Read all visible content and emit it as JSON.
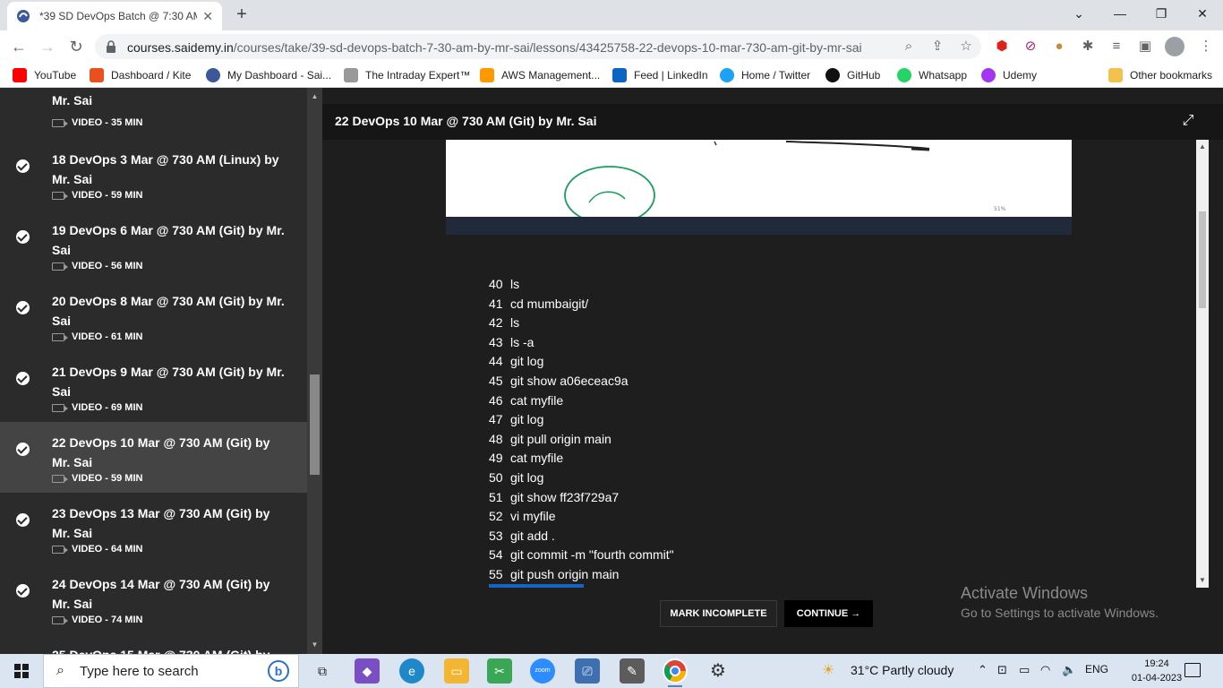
{
  "browser": {
    "tab_title": "*39 SD DevOps Batch @ 7:30 AM",
    "url_host": "courses.saidemy.in",
    "url_path": "/courses/take/39-sd-devops-batch-7-30-am-by-mr-sai/lessons/43425758-22-devops-10-mar-730-am-git-by-mr-sai"
  },
  "bookmarks": [
    {
      "label": "YouTube",
      "color": "#ff0000"
    },
    {
      "label": "Dashboard / Kite",
      "color": "#e8501e"
    },
    {
      "label": "My Dashboard - Sai...",
      "color": "#3b5998"
    },
    {
      "label": "The Intraday Expert™",
      "color": "#888888"
    },
    {
      "label": "AWS Management...",
      "color": "#ff9900"
    },
    {
      "label": "Feed | LinkedIn",
      "color": "#0a66c2"
    },
    {
      "label": "Home / Twitter",
      "color": "#1da1f2"
    },
    {
      "label": "GitHub",
      "color": "#111111"
    },
    {
      "label": "Whatsapp",
      "color": "#25d366"
    },
    {
      "label": "Udemy",
      "color": "#a435f0"
    },
    {
      "label": "Other bookmarks",
      "color": "#f2c14e"
    }
  ],
  "sidebar": {
    "top_partial": {
      "title": "Mr. Sai",
      "meta": "VIDEO - 35 MIN"
    },
    "lessons": [
      {
        "title": "18 DevOps 3 Mar @ 730 AM (Linux) by Mr. Sai",
        "meta": "VIDEO - 59 MIN",
        "completed": true
      },
      {
        "title": "19 DevOps 6 Mar @ 730 AM (Git) by Mr. Sai",
        "meta": "VIDEO - 56 MIN",
        "completed": true
      },
      {
        "title": "20 DevOps 8 Mar @ 730 AM (Git) by Mr. Sai",
        "meta": "VIDEO - 61 MIN",
        "completed": true
      },
      {
        "title": "21 DevOps 9 Mar @ 730 AM (Git) by Mr. Sai",
        "meta": "VIDEO - 69 MIN",
        "completed": true
      },
      {
        "title": "22 DevOps 10 Mar @ 730 AM (Git) by Mr. Sai",
        "meta": "VIDEO - 59 MIN",
        "completed": true,
        "active": true
      },
      {
        "title": "23 DevOps 13 Mar @ 730 AM (Git) by Mr. Sai",
        "meta": "VIDEO - 64 MIN",
        "completed": true
      },
      {
        "title": "24 DevOps 14 Mar @ 730 AM (Git) by Mr. Sai",
        "meta": "VIDEO - 74 MIN",
        "completed": true
      },
      {
        "title": "25 DevOps 15 Mar @ 730 AM (Git) by",
        "meta": "",
        "completed": true
      }
    ]
  },
  "main": {
    "lesson_title": "22 DevOps 10 Mar @ 730 AM (Git) by Mr. Sai",
    "commands": [
      {
        "n": "40",
        "cmd": "ls"
      },
      {
        "n": "41",
        "cmd": "cd mumbaigit/"
      },
      {
        "n": "42",
        "cmd": "ls"
      },
      {
        "n": "43",
        "cmd": "ls -a"
      },
      {
        "n": "44",
        "cmd": "git log"
      },
      {
        "n": "45",
        "cmd": "git show a06eceac9a"
      },
      {
        "n": "46",
        "cmd": "cat myfile"
      },
      {
        "n": "47",
        "cmd": "git log"
      },
      {
        "n": "48",
        "cmd": "git pull origin main"
      },
      {
        "n": "49",
        "cmd": "cat myfile"
      },
      {
        "n": "50",
        "cmd": "git log"
      },
      {
        "n": "51",
        "cmd": "git show ff23f729a7"
      },
      {
        "n": "52",
        "cmd": "vi myfile"
      },
      {
        "n": "53",
        "cmd": "git add ."
      },
      {
        "n": "54",
        "cmd": "git commit -m \"fourth commit\""
      },
      {
        "n": "55",
        "cmd": "git push origin main"
      }
    ],
    "mark_incomplete": "MARK INCOMPLETE",
    "continue": "CONTINUE →",
    "watermark_title": "Activate Windows",
    "watermark_sub": "Go to Settings to activate Windows."
  },
  "taskbar": {
    "search_placeholder": "Type here to search",
    "weather": "31°C  Partly cloudy",
    "lang": "ENG",
    "time": "19:24",
    "date": "01-04-2023"
  }
}
